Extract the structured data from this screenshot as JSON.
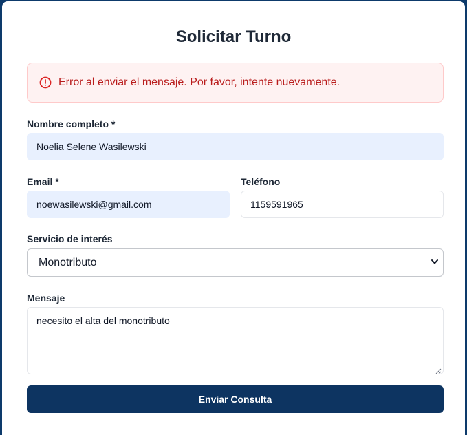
{
  "form": {
    "title": "Solicitar Turno",
    "error_message": "Error al enviar el mensaje. Por favor, intente nuevamente.",
    "name": {
      "label": "Nombre completo *",
      "value": "Noelia Selene Wasilewski"
    },
    "email": {
      "label": "Email *",
      "value": "noewasilewski@gmail.com"
    },
    "phone": {
      "label": "Teléfono",
      "value": "1159591965"
    },
    "service": {
      "label": "Servicio de interés",
      "value": "Monotributo"
    },
    "message": {
      "label": "Mensaje",
      "value": "necesito el alta del monotributo"
    },
    "submit_label": "Enviar Consulta"
  },
  "icons": {
    "alert": "alert-circle-icon",
    "select": "chevron-down-icon",
    "resize": "resize-handle-icon"
  },
  "colors": {
    "page_background": "#0d3a6b",
    "error_text": "#b91c1c",
    "error_background": "#fef2f2",
    "autofill_background": "#e8f0fe",
    "button_background": "#0d3461"
  }
}
